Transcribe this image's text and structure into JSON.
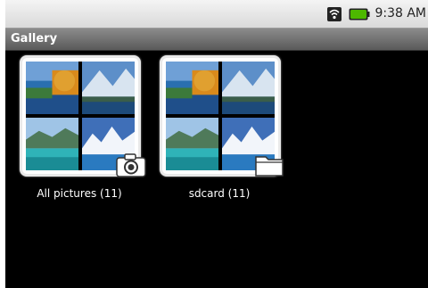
{
  "status_bar": {
    "time": "9:38 AM"
  },
  "title_bar": {
    "title": "Gallery"
  },
  "albums": [
    {
      "label": "All pictures (11)",
      "badge_icon": "camera-icon"
    },
    {
      "label": "sdcard (11)",
      "badge_icon": "folder-icon"
    }
  ],
  "colors": {
    "status_bar_bg": "#e4e4e4",
    "title_bar_bg": "#6e6e6e",
    "battery_green": "#4db800",
    "screen_bg": "#000000"
  }
}
